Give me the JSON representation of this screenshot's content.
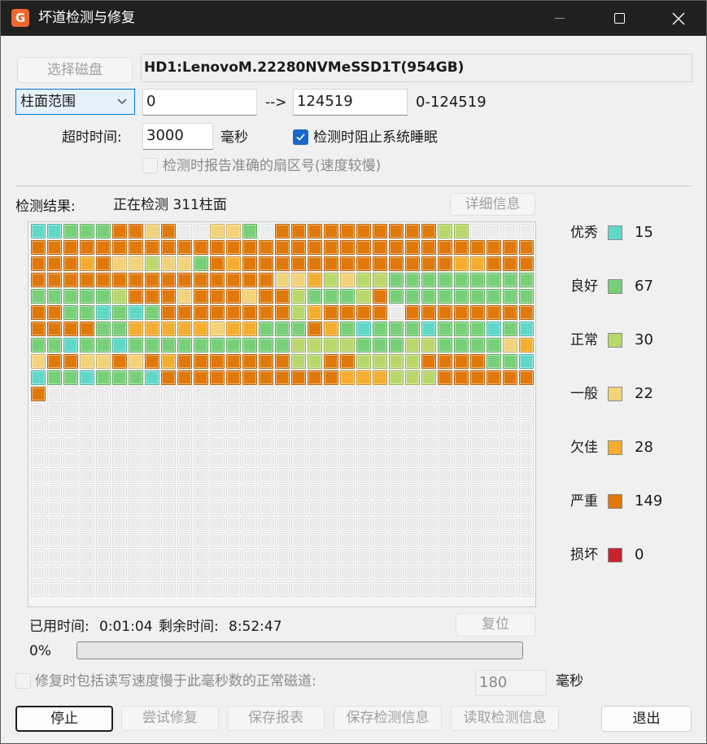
{
  "window": {
    "title": "坏道检测与修复",
    "app_icon_glyph": "G"
  },
  "disk": {
    "select_button": "选择磁盘",
    "name": "HD1:LenovoM.22280NVMeSSD1T(954GB)"
  },
  "range": {
    "mode": "柱面范围",
    "from": "0",
    "arrow": "-->",
    "to": "124519",
    "limit_text": "0-124519"
  },
  "timeout": {
    "label": "超时时间:",
    "value": "3000",
    "unit": "毫秒"
  },
  "options": {
    "prevent_sleep": {
      "label": "检测时阻止系统睡眠",
      "checked": true
    },
    "report_exact_sector": {
      "label": "检测时报告准确的扇区号(速度较慢)",
      "checked": false
    }
  },
  "result": {
    "label": "检测结果:",
    "status": "正在检测 311柱面",
    "detail_button": "详细信息"
  },
  "legend": [
    {
      "label": "优秀",
      "count": "15",
      "color": "#5fd8c8"
    },
    {
      "label": "良好",
      "count": "67",
      "color": "#77d077"
    },
    {
      "label": "正常",
      "count": "30",
      "color": "#b9d86b"
    },
    {
      "label": "一般",
      "count": "22",
      "color": "#f3d37a"
    },
    {
      "label": "欠佳",
      "count": "28",
      "color": "#f4ad2f"
    },
    {
      "label": "严重",
      "count": "149",
      "color": "#e0780a"
    },
    {
      "label": "损坏",
      "count": "0",
      "color": "#c8232c"
    }
  ],
  "empty_cell_color": "#ebebeb",
  "grid": {
    "columns": 31,
    "total_rows": 23,
    "rows": [
      "EEGGGSSYSOOYYGOSSSSSSSSSSNNOOOO",
      "SSSSSSSSSSSSSSSSSSSSSSSSSSSSSSS",
      "SSSPSYYNYYGSPSSSSSSSSSSSSSPPSSS",
      "SSSSSSSSSSSSSSSYYPNYNNGGGGGGGGG",
      "GGGGGNSSSYSSSYSSNGGGNSGGGGGGGGG",
      "SSGGEGEGSSSSSSSSNPSSSSOSSSSSSSS",
      "SSSSGGPPPPPYPPGGGSPGEGGGEGGGEGE",
      "GGEGGEGGGGGGGGGGNNNNGGGNNGGGGYP",
      "YSSYYSYSPSSSSSSSNNSSNNNNSSSSGGE",
      "EGGEGGGESSSSSSSSSSSPPPNNNSSSSSS",
      "S"
    ]
  },
  "timing": {
    "elapsed_label": "已用时间:",
    "elapsed": "0:01:04",
    "remaining_label": "剩余时间:",
    "remaining": "8:52:47",
    "reset_button": "复位"
  },
  "progress": {
    "percent_text": "0%",
    "fraction": 0.0
  },
  "repair_slow": {
    "label": "修复时包括读写速度慢于此毫秒数的正常磁道:",
    "checked": false,
    "value": "180",
    "unit": "毫秒"
  },
  "buttons": {
    "stop": "停止",
    "try_repair": "尝试修复",
    "save_report": "保存报表",
    "save_info": "保存检测信息",
    "load_info": "读取检测信息",
    "exit": "退出"
  }
}
